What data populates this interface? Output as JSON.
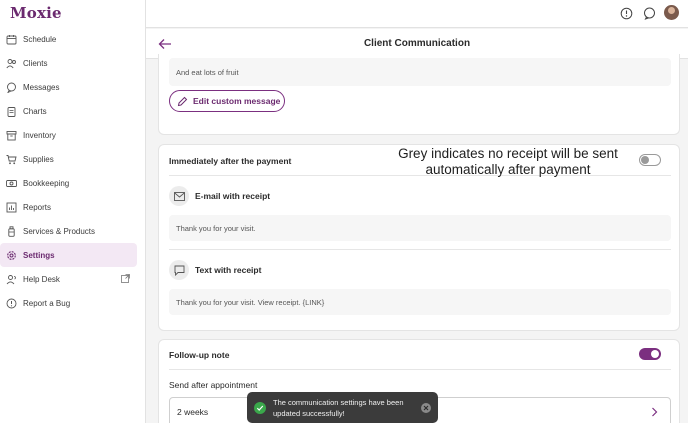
{
  "app": {
    "logo": "Moxie"
  },
  "sidebar": {
    "items": [
      {
        "label": "Schedule",
        "icon": "calendar-icon"
      },
      {
        "label": "Clients",
        "icon": "users-icon"
      },
      {
        "label": "Messages",
        "icon": "chat-icon"
      },
      {
        "label": "Charts",
        "icon": "clipboard-icon"
      },
      {
        "label": "Inventory",
        "icon": "archive-icon"
      },
      {
        "label": "Supplies",
        "icon": "cart-icon"
      },
      {
        "label": "Bookkeeping",
        "icon": "money-icon"
      },
      {
        "label": "Reports",
        "icon": "bar-chart-icon"
      },
      {
        "label": "Services & Products",
        "icon": "bottle-icon"
      },
      {
        "label": "Settings",
        "icon": "gear-icon",
        "active": true
      },
      {
        "label": "Help Desk",
        "icon": "user-help-icon"
      },
      {
        "label": "Report a Bug",
        "icon": "alert-icon"
      }
    ]
  },
  "header": {
    "title": "Client Communication"
  },
  "custom_message": {
    "text": "And eat lots of fruit",
    "edit_label": "Edit custom message"
  },
  "after_payment": {
    "title": "Immediately after the payment",
    "toggle_on": false,
    "email": {
      "label": "E-mail with receipt",
      "message": "Thank you for your visit."
    },
    "text": {
      "label": "Text with receipt",
      "message": "Thank you for your visit. View receipt. {LINK}"
    }
  },
  "annotation": {
    "line1": "Grey indicates no receipt will be sent",
    "line2": "automatically after payment"
  },
  "follow_up": {
    "title": "Follow-up note",
    "toggle_on": true,
    "send_after_label": "Send after appointment",
    "send_after_value": "2 weeks"
  },
  "toast": {
    "line1": "The communication settings have been",
    "line2": "updated successfully!"
  },
  "colors": {
    "accent": "#7b2f80",
    "logo": "#6b2a6f",
    "toast_bg": "#3b3b3b",
    "success": "#3aa84b"
  }
}
